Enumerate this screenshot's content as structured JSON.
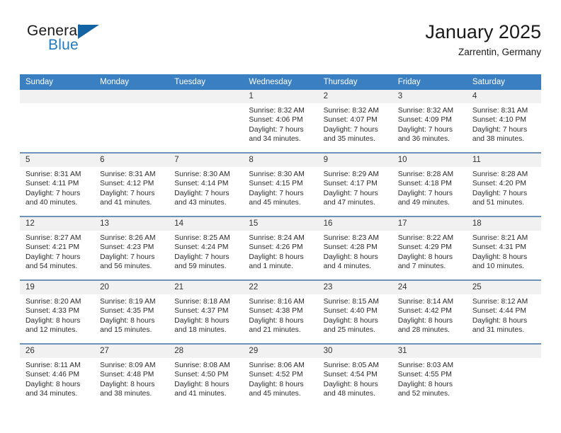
{
  "brand": {
    "name_part1": "General",
    "name_part2": "Blue",
    "logo_icon": "triangle-logo-icon"
  },
  "header": {
    "title": "January 2025",
    "location": "Zarrentin, Germany"
  },
  "colors": {
    "header_blue": "#3a7fc1",
    "brand_blue": "#1f7ac0",
    "logo_blue": "#1464a5",
    "daynum_band": "#f1f1f1",
    "row_divider": "#6e93b8"
  },
  "weekday_headers": [
    "Sunday",
    "Monday",
    "Tuesday",
    "Wednesday",
    "Thursday",
    "Friday",
    "Saturday"
  ],
  "labels": {
    "sunrise_prefix": "Sunrise:",
    "sunset_prefix": "Sunset:",
    "daylight_prefix": "Daylight:"
  },
  "weeks": [
    [
      {
        "empty": true,
        "day": "",
        "sunrise": "",
        "sunset": "",
        "daylight_line1": "",
        "daylight_line2": ""
      },
      {
        "empty": true,
        "day": "",
        "sunrise": "",
        "sunset": "",
        "daylight_line1": "",
        "daylight_line2": ""
      },
      {
        "empty": true,
        "day": "",
        "sunrise": "",
        "sunset": "",
        "daylight_line1": "",
        "daylight_line2": ""
      },
      {
        "empty": false,
        "day": "1",
        "sunrise": "Sunrise: 8:32 AM",
        "sunset": "Sunset: 4:06 PM",
        "daylight_line1": "Daylight: 7 hours",
        "daylight_line2": "and 34 minutes."
      },
      {
        "empty": false,
        "day": "2",
        "sunrise": "Sunrise: 8:32 AM",
        "sunset": "Sunset: 4:07 PM",
        "daylight_line1": "Daylight: 7 hours",
        "daylight_line2": "and 35 minutes."
      },
      {
        "empty": false,
        "day": "3",
        "sunrise": "Sunrise: 8:32 AM",
        "sunset": "Sunset: 4:09 PM",
        "daylight_line1": "Daylight: 7 hours",
        "daylight_line2": "and 36 minutes."
      },
      {
        "empty": false,
        "day": "4",
        "sunrise": "Sunrise: 8:31 AM",
        "sunset": "Sunset: 4:10 PM",
        "daylight_line1": "Daylight: 7 hours",
        "daylight_line2": "and 38 minutes."
      }
    ],
    [
      {
        "empty": false,
        "day": "5",
        "sunrise": "Sunrise: 8:31 AM",
        "sunset": "Sunset: 4:11 PM",
        "daylight_line1": "Daylight: 7 hours",
        "daylight_line2": "and 40 minutes."
      },
      {
        "empty": false,
        "day": "6",
        "sunrise": "Sunrise: 8:31 AM",
        "sunset": "Sunset: 4:12 PM",
        "daylight_line1": "Daylight: 7 hours",
        "daylight_line2": "and 41 minutes."
      },
      {
        "empty": false,
        "day": "7",
        "sunrise": "Sunrise: 8:30 AM",
        "sunset": "Sunset: 4:14 PM",
        "daylight_line1": "Daylight: 7 hours",
        "daylight_line2": "and 43 minutes."
      },
      {
        "empty": false,
        "day": "8",
        "sunrise": "Sunrise: 8:30 AM",
        "sunset": "Sunset: 4:15 PM",
        "daylight_line1": "Daylight: 7 hours",
        "daylight_line2": "and 45 minutes."
      },
      {
        "empty": false,
        "day": "9",
        "sunrise": "Sunrise: 8:29 AM",
        "sunset": "Sunset: 4:17 PM",
        "daylight_line1": "Daylight: 7 hours",
        "daylight_line2": "and 47 minutes."
      },
      {
        "empty": false,
        "day": "10",
        "sunrise": "Sunrise: 8:28 AM",
        "sunset": "Sunset: 4:18 PM",
        "daylight_line1": "Daylight: 7 hours",
        "daylight_line2": "and 49 minutes."
      },
      {
        "empty": false,
        "day": "11",
        "sunrise": "Sunrise: 8:28 AM",
        "sunset": "Sunset: 4:20 PM",
        "daylight_line1": "Daylight: 7 hours",
        "daylight_line2": "and 51 minutes."
      }
    ],
    [
      {
        "empty": false,
        "day": "12",
        "sunrise": "Sunrise: 8:27 AM",
        "sunset": "Sunset: 4:21 PM",
        "daylight_line1": "Daylight: 7 hours",
        "daylight_line2": "and 54 minutes."
      },
      {
        "empty": false,
        "day": "13",
        "sunrise": "Sunrise: 8:26 AM",
        "sunset": "Sunset: 4:23 PM",
        "daylight_line1": "Daylight: 7 hours",
        "daylight_line2": "and 56 minutes."
      },
      {
        "empty": false,
        "day": "14",
        "sunrise": "Sunrise: 8:25 AM",
        "sunset": "Sunset: 4:24 PM",
        "daylight_line1": "Daylight: 7 hours",
        "daylight_line2": "and 59 minutes."
      },
      {
        "empty": false,
        "day": "15",
        "sunrise": "Sunrise: 8:24 AM",
        "sunset": "Sunset: 4:26 PM",
        "daylight_line1": "Daylight: 8 hours",
        "daylight_line2": "and 1 minute."
      },
      {
        "empty": false,
        "day": "16",
        "sunrise": "Sunrise: 8:23 AM",
        "sunset": "Sunset: 4:28 PM",
        "daylight_line1": "Daylight: 8 hours",
        "daylight_line2": "and 4 minutes."
      },
      {
        "empty": false,
        "day": "17",
        "sunrise": "Sunrise: 8:22 AM",
        "sunset": "Sunset: 4:29 PM",
        "daylight_line1": "Daylight: 8 hours",
        "daylight_line2": "and 7 minutes."
      },
      {
        "empty": false,
        "day": "18",
        "sunrise": "Sunrise: 8:21 AM",
        "sunset": "Sunset: 4:31 PM",
        "daylight_line1": "Daylight: 8 hours",
        "daylight_line2": "and 10 minutes."
      }
    ],
    [
      {
        "empty": false,
        "day": "19",
        "sunrise": "Sunrise: 8:20 AM",
        "sunset": "Sunset: 4:33 PM",
        "daylight_line1": "Daylight: 8 hours",
        "daylight_line2": "and 12 minutes."
      },
      {
        "empty": false,
        "day": "20",
        "sunrise": "Sunrise: 8:19 AM",
        "sunset": "Sunset: 4:35 PM",
        "daylight_line1": "Daylight: 8 hours",
        "daylight_line2": "and 15 minutes."
      },
      {
        "empty": false,
        "day": "21",
        "sunrise": "Sunrise: 8:18 AM",
        "sunset": "Sunset: 4:37 PM",
        "daylight_line1": "Daylight: 8 hours",
        "daylight_line2": "and 18 minutes."
      },
      {
        "empty": false,
        "day": "22",
        "sunrise": "Sunrise: 8:16 AM",
        "sunset": "Sunset: 4:38 PM",
        "daylight_line1": "Daylight: 8 hours",
        "daylight_line2": "and 21 minutes."
      },
      {
        "empty": false,
        "day": "23",
        "sunrise": "Sunrise: 8:15 AM",
        "sunset": "Sunset: 4:40 PM",
        "daylight_line1": "Daylight: 8 hours",
        "daylight_line2": "and 25 minutes."
      },
      {
        "empty": false,
        "day": "24",
        "sunrise": "Sunrise: 8:14 AM",
        "sunset": "Sunset: 4:42 PM",
        "daylight_line1": "Daylight: 8 hours",
        "daylight_line2": "and 28 minutes."
      },
      {
        "empty": false,
        "day": "25",
        "sunrise": "Sunrise: 8:12 AM",
        "sunset": "Sunset: 4:44 PM",
        "daylight_line1": "Daylight: 8 hours",
        "daylight_line2": "and 31 minutes."
      }
    ],
    [
      {
        "empty": false,
        "day": "26",
        "sunrise": "Sunrise: 8:11 AM",
        "sunset": "Sunset: 4:46 PM",
        "daylight_line1": "Daylight: 8 hours",
        "daylight_line2": "and 34 minutes."
      },
      {
        "empty": false,
        "day": "27",
        "sunrise": "Sunrise: 8:09 AM",
        "sunset": "Sunset: 4:48 PM",
        "daylight_line1": "Daylight: 8 hours",
        "daylight_line2": "and 38 minutes."
      },
      {
        "empty": false,
        "day": "28",
        "sunrise": "Sunrise: 8:08 AM",
        "sunset": "Sunset: 4:50 PM",
        "daylight_line1": "Daylight: 8 hours",
        "daylight_line2": "and 41 minutes."
      },
      {
        "empty": false,
        "day": "29",
        "sunrise": "Sunrise: 8:06 AM",
        "sunset": "Sunset: 4:52 PM",
        "daylight_line1": "Daylight: 8 hours",
        "daylight_line2": "and 45 minutes."
      },
      {
        "empty": false,
        "day": "30",
        "sunrise": "Sunrise: 8:05 AM",
        "sunset": "Sunset: 4:54 PM",
        "daylight_line1": "Daylight: 8 hours",
        "daylight_line2": "and 48 minutes."
      },
      {
        "empty": false,
        "day": "31",
        "sunrise": "Sunrise: 8:03 AM",
        "sunset": "Sunset: 4:55 PM",
        "daylight_line1": "Daylight: 8 hours",
        "daylight_line2": "and 52 minutes."
      },
      {
        "empty": true,
        "day": "",
        "sunrise": "",
        "sunset": "",
        "daylight_line1": "",
        "daylight_line2": ""
      }
    ]
  ]
}
